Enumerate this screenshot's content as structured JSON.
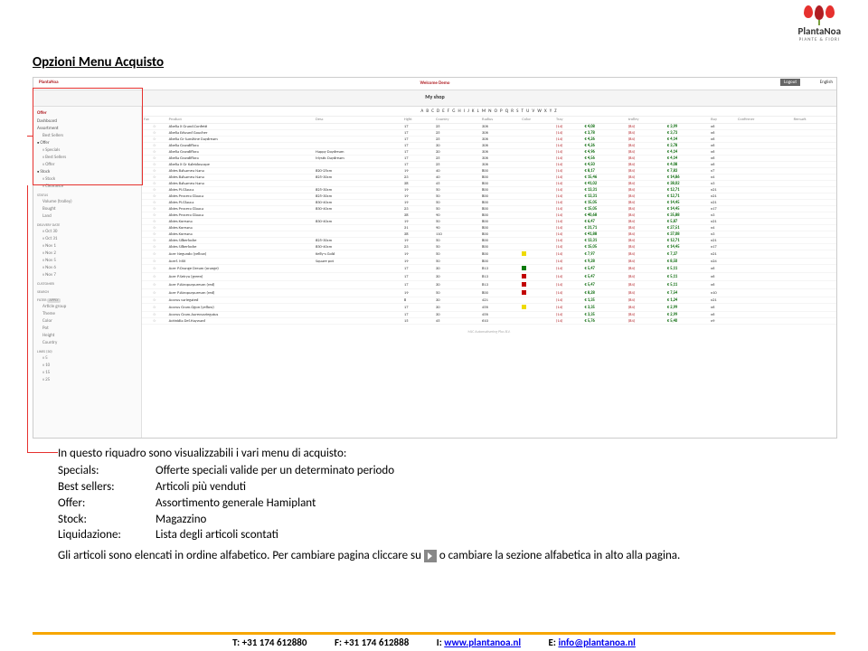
{
  "logo": {
    "name": "PlantaNoa",
    "tagline": "PIANTE & FIORI"
  },
  "page_title": "Opzioni Menu Acquisto",
  "screenshot": {
    "welcome": "Welcome Demo",
    "logout": "Logout",
    "lang": "English",
    "myshop": "My shop",
    "sidebar": {
      "offer_label": "Offer",
      "dashboard": "Dashboard",
      "assortment": "Assortment",
      "best_sellers": "Best Sellers",
      "offer_group": "Offer",
      "specials": "Specials",
      "best_sellers2": "Best Sellers",
      "offer_item": "Offer",
      "stock": "Stock",
      "stock_item": "Stock",
      "clearance": "Clearance",
      "status_head": "Status",
      "volume": "Volume (trolley)",
      "bought": "Bought",
      "land": "Land",
      "delivery_head": "Delivery date",
      "d1": "Oct 30",
      "d2": "Oct 31",
      "d3": "Nov 1",
      "d4": "Nov 2",
      "d5": "Nov 5",
      "d6": "Nov 6",
      "d7": "Nov 7",
      "customer_head": "Customer",
      "search_head": "Search",
      "filter_head": "Filter",
      "apply": "Apply",
      "filter1": "Article group",
      "filter2": "Theme",
      "filter3": "Color",
      "filter4": "Pot",
      "filter5": "Height",
      "filter6": "Country",
      "lines_head": "Lines (30)",
      "l5": "5",
      "l10": "10",
      "l15": "15",
      "l25": "25"
    },
    "alphabet": "A B C D E F G H I J K L M N O P Q R S T U V W X Y Z",
    "columns": {
      "fav": "Fav",
      "product": "Product",
      "desc": "Desc",
      "height": "Hght",
      "country": "Country",
      "radius": "Radius",
      "color": "Color",
      "tray": "Tray",
      "trolley": "trolley",
      "buy": "Buy",
      "confirmer": "Confirmer",
      "remark": "Remark"
    },
    "rows": [
      {
        "p": "Abelia X Grand.Confetti",
        "d": "",
        "h": "17",
        "c": "25",
        "r": "306",
        "t": "(14)",
        "p1": "€ 4,08",
        "p2": "(84)",
        "p3": "€ 3,99",
        "buy": "x6"
      },
      {
        "p": "Abelia Edward Goucher",
        "d": "",
        "h": "17",
        "c": "25",
        "r": "306",
        "t": "(14)",
        "p1": "€ 3,78",
        "p2": "(84)",
        "p3": "€ 3,73",
        "buy": "x6"
      },
      {
        "p": "Abelia Gr Sunshine Daydream",
        "d": "",
        "h": "17",
        "c": "25",
        "r": "306",
        "t": "(14)",
        "p1": "€ 4,26",
        "p2": "(84)",
        "p3": "€ 4,14",
        "buy": "x6"
      },
      {
        "p": "Abelia Grandiflora",
        "d": "",
        "h": "17",
        "c": "30",
        "r": "306",
        "t": "(14)",
        "p1": "€ 4,26",
        "p2": "(84)",
        "p3": "€ 3,78",
        "buy": "x6"
      },
      {
        "p": "Abelia Grandiflora",
        "d": "Happy Daydream",
        "h": "17",
        "c": "20",
        "r": "306",
        "t": "(14)",
        "p1": "€ 4,96",
        "p2": "(84)",
        "p3": "€ 4,14",
        "buy": "x6"
      },
      {
        "p": "Abelia Grandiflora",
        "d": "Mystic Daydream",
        "h": "17",
        "c": "25",
        "r": "306",
        "t": "(14)",
        "p1": "€ 4,56",
        "p2": "(84)",
        "p3": "€ 4,14",
        "buy": "x6"
      },
      {
        "p": "Abelia X Gr Kaleidoscope",
        "d": "",
        "h": "17",
        "c": "25",
        "r": "306",
        "t": "(14)",
        "p1": "€ 4,50",
        "p2": "(84)",
        "p3": "€ 4,08",
        "buy": "x6"
      },
      {
        "p": "Abies Balsamea Nana",
        "d": "#20-25cm",
        "h": "19",
        "c": "40",
        "r": "800",
        "t": "(14)",
        "p1": "€ 8,17",
        "p2": "(84)",
        "p3": "€ 7,83",
        "buy": "x7"
      },
      {
        "p": "Abies Balsamea Nana",
        "d": "#25-30cm",
        "h": "23",
        "c": "40",
        "r": "800",
        "t": "(14)",
        "p1": "€ 15,46",
        "p2": "(84)",
        "p3": "€ 14,86",
        "buy": "x4"
      },
      {
        "p": "Abies Balsamea Nana",
        "d": "",
        "h": "38",
        "c": "45",
        "r": "800",
        "t": "(14)",
        "p1": "€ 41,02",
        "p2": "(84)",
        "p3": "€ 38,02",
        "buy": "x3"
      },
      {
        "p": "Abies Pi.Glauca",
        "d": "#25-30cm",
        "h": "19",
        "c": "50",
        "r": "800",
        "t": "(14)",
        "p1": "€ 13,31",
        "p2": "(84)",
        "p3": "€ 12,71",
        "buy": "x21"
      },
      {
        "p": "Abies Procera Glauca",
        "d": "#25-30cm",
        "h": "19",
        "c": "50",
        "r": "800",
        "t": "(14)",
        "p1": "€ 13,31",
        "p2": "(84)",
        "p3": "€ 12,71",
        "buy": "x21"
      },
      {
        "p": "Abies Pi.Glauca",
        "d": "#30-40cm",
        "h": "19",
        "c": "50",
        "r": "800",
        "t": "(14)",
        "p1": "€ 15,05",
        "p2": "(84)",
        "p3": "€ 14,45",
        "buy": "x21"
      },
      {
        "p": "Abies Procera Glauca",
        "d": "#30-40cm",
        "h": "23",
        "c": "50",
        "r": "800",
        "t": "(14)",
        "p1": "€ 15,05",
        "p2": "(84)",
        "p3": "€ 14,45",
        "buy": "x17"
      },
      {
        "p": "Abies Procera Glauca",
        "d": "",
        "h": "38",
        "c": "90",
        "r": "800",
        "t": "(14)",
        "p1": "€ 40,68",
        "p2": "(84)",
        "p3": "€ 35,88",
        "buy": "x3"
      },
      {
        "p": "Abies Koreana",
        "d": "#30-40cm",
        "h": "19",
        "c": "50",
        "r": "800",
        "t": "(14)",
        "p1": "€ 6,47",
        "p2": "(84)",
        "p3": "€ 5,87",
        "buy": "x21"
      },
      {
        "p": "Abies Koreana",
        "d": "",
        "h": "31",
        "c": "90",
        "r": "800",
        "t": "(14)",
        "p1": "€ 31,71",
        "p2": "(84)",
        "p3": "€ 27,51",
        "buy": "x4"
      },
      {
        "p": "Abies Koreana",
        "d": "",
        "h": "38",
        "c": "110",
        "r": "800",
        "t": "(14)",
        "p1": "€ 41,88",
        "p2": "(84)",
        "p3": "€ 37,08",
        "buy": "x3"
      },
      {
        "p": "Abies Silberlocke",
        "d": "#25-30cm",
        "h": "19",
        "c": "50",
        "r": "800",
        "t": "(14)",
        "p1": "€ 13,31",
        "p2": "(84)",
        "p3": "€ 12,71",
        "buy": "x21"
      },
      {
        "p": "Abies Silberlocke",
        "d": "#30-40cm",
        "h": "23",
        "c": "50",
        "r": "800",
        "t": "(14)",
        "p1": "€ 15,05",
        "p2": "(84)",
        "p3": "€ 14,45",
        "buy": "x17"
      },
      {
        "p": "Acer Negundo (yellow)",
        "d": "Kelly-s Gold",
        "h": "19",
        "c": "50",
        "r": "800",
        "t": "(14)",
        "p1": "€ 7,97",
        "p2": "(84)",
        "p3": "€ 7,37",
        "buy": "x21",
        "cl": "y"
      },
      {
        "p": "Acerl. MiX",
        "d": "Square pot",
        "h": "19",
        "c": "50",
        "r": "800",
        "t": "(14)",
        "p1": "€ 9,28",
        "p2": "(84)",
        "p3": "€ 8,50",
        "buy": "x24"
      },
      {
        "p": "Acer P.Orange Dream (orange)",
        "d": "",
        "h": "17",
        "c": "30",
        "r": "813",
        "t": "(14)",
        "p1": "€ 5,47",
        "p2": "(84)",
        "p3": "€ 5,11",
        "buy": "x6",
        "cl": "g"
      },
      {
        "p": "Acer P.Seiryu (green)",
        "d": "",
        "h": "17",
        "c": "30",
        "r": "813",
        "t": "(14)",
        "p1": "€ 5,47",
        "p2": "(84)",
        "p3": "€ 5,11",
        "buy": "x6",
        "cl": "r"
      },
      {
        "p": "Acer P.Atropurpureum (red)",
        "d": "",
        "h": "17",
        "c": "30",
        "r": "813",
        "t": "(14)",
        "p1": "€ 5,47",
        "p2": "(84)",
        "p3": "€ 5,11",
        "buy": "x6",
        "cl": "r"
      },
      {
        "p": "Acer P.Atropurpureum (red)",
        "d": "",
        "h": "19",
        "c": "50",
        "r": "800",
        "t": "(14)",
        "p1": "€ 8,28",
        "p2": "(84)",
        "p3": "€ 7,54",
        "buy": "x10",
        "cl": "r"
      },
      {
        "p": "Acorus variegated",
        "d": "",
        "h": "8",
        "c": "30",
        "r": "421",
        "t": "(14)",
        "p1": "€ 1,35",
        "p2": "(84)",
        "p3": "€ 1,24",
        "buy": "x21"
      },
      {
        "p": "Acorus Gram.Ogon (yellow)",
        "d": "",
        "h": "17",
        "c": "30",
        "r": "456",
        "t": "(14)",
        "p1": "€ 3,35",
        "p2": "(84)",
        "p3": "€ 2,99",
        "buy": "x6",
        "cl": "y"
      },
      {
        "p": "Acorus Gram.Aureovariegatus",
        "d": "",
        "h": "17",
        "c": "30",
        "r": "456",
        "t": "(14)",
        "p1": "€ 3,35",
        "p2": "(84)",
        "p3": "€ 2,99",
        "buy": "x6"
      },
      {
        "p": "Actinidia Del.Hayward",
        "d": "",
        "h": "15",
        "c": "45",
        "r": "610",
        "t": "(14)",
        "p1": "€ 5,76",
        "p2": "(84)",
        "p3": "€ 5,40",
        "buy": "x9"
      }
    ],
    "footer_small": "MJC Automatisering Plus B.V."
  },
  "intro": "In questo riquadro sono visualizzabili i vari menu di acquisto:",
  "defs": [
    {
      "k": "Specials:",
      "v": "Offerte speciali valide per  un determinato periodo"
    },
    {
      "k": "Best sellers:",
      "v": "Articoli più venduti"
    },
    {
      "k": "Offer:",
      "v": "Assortimento generale Hamiplant"
    },
    {
      "k": "Stock:",
      "v": "Magazzino"
    },
    {
      "k": "Liquidazione:",
      "v": "Lista degli articoli scontati"
    }
  ],
  "sentence1": "Gli articoli sono elencati in ordine alfabetico. Per cambiare pagina cliccare su ",
  "sentence2": " o cambiare la sezione alfabetica in alto alla pagina.",
  "footer": {
    "t": "T: +31 174 612880",
    "f": "F: +31 174 612888",
    "i_label": "I: ",
    "i_link": "www.plantanoa.nl",
    "e_label": "E: ",
    "e_link": "info@plantanoa.nl"
  }
}
